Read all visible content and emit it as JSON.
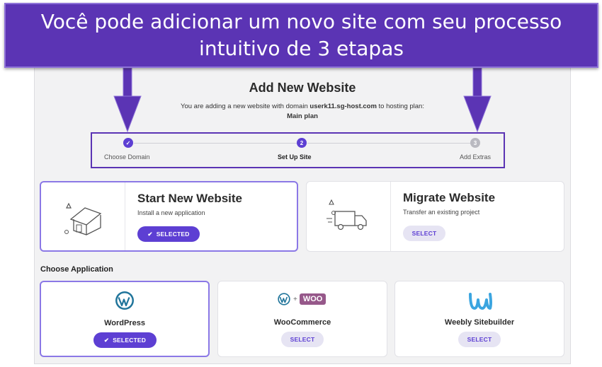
{
  "banner": {
    "line1": "Você pode adicionar um novo site com seu processo",
    "line2": "intuitivo de 3 etapas"
  },
  "page": {
    "title": "Add New Website",
    "subtitle_prefix": "You are adding a new website with domain ",
    "domain": "userk11.sg-host.com",
    "subtitle_suffix": " to hosting plan:",
    "plan": "Main plan"
  },
  "steps": [
    {
      "number": "✓",
      "label": "Choose Domain",
      "state": "done"
    },
    {
      "number": "2",
      "label": "Set Up Site",
      "state": "active"
    },
    {
      "number": "3",
      "label": "Add Extras",
      "state": "pending"
    }
  ],
  "options": {
    "start": {
      "title": "Start New Website",
      "desc": "Install a new application",
      "button": "SELECTED"
    },
    "migrate": {
      "title": "Migrate Website",
      "desc": "Transfer an existing project",
      "button": "SELECT"
    }
  },
  "apps_section": {
    "title": "Choose Application"
  },
  "apps": [
    {
      "name": "WordPress",
      "button": "SELECTED",
      "icon": "wordpress-icon"
    },
    {
      "name": "WooCommerce",
      "button": "SELECT",
      "icon": "woocommerce-icon",
      "badge": "WOO"
    },
    {
      "name": "Weebly Sitebuilder",
      "button": "SELECT",
      "icon": "weebly-icon"
    }
  ],
  "colors": {
    "banner": "#5b34b4",
    "accent": "#5d3fd3",
    "arrow": "#5b34b4"
  }
}
